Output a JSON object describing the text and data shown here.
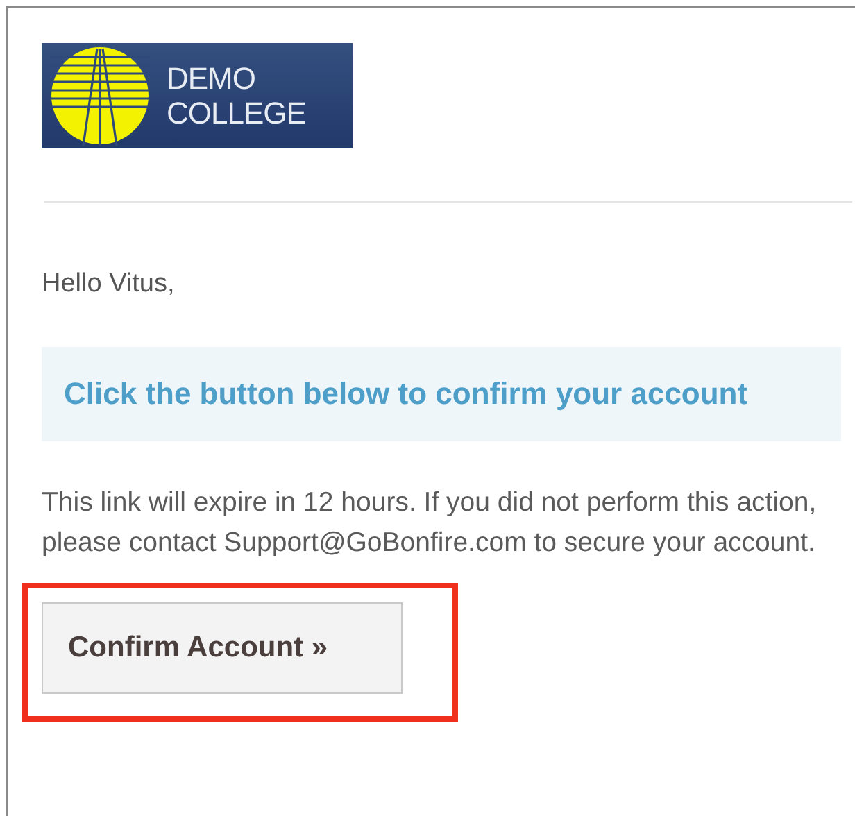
{
  "logo": {
    "lines": [
      "DEMO",
      "COLLEGE"
    ]
  },
  "greeting": "Hello Vitus,",
  "callout": "Click the button below to confirm your account",
  "message": "This link will expire in 12 hours. If you did not perform this action, please contact Support@GoBonfire.com to secure your account.",
  "button": {
    "label": "Confirm Account »",
    "highlighted": true
  }
}
